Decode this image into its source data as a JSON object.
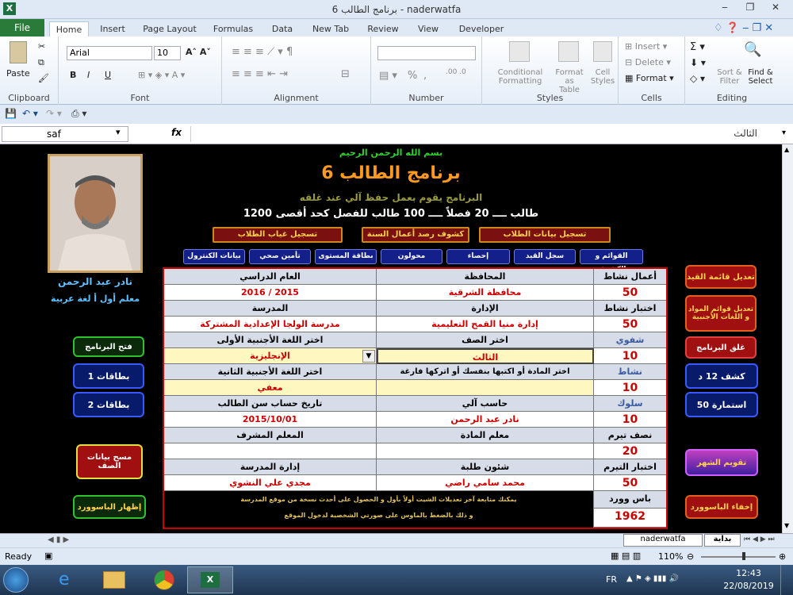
{
  "window": {
    "title": "برنامج الطالب 6  -  naderwatfa",
    "min": "▭",
    "restore": "🗗",
    "close": "✕"
  },
  "tabs": [
    "File",
    "Home",
    "Insert",
    "Page Layout",
    "Formulas",
    "Data",
    "New Tab",
    "Review",
    "View",
    "Developer"
  ],
  "ribbon": {
    "clipboard": {
      "paste": "Paste",
      "label": "Clipboard"
    },
    "font": {
      "name": "Arial",
      "size": "10",
      "label": "Font",
      "bold": "B",
      "italic": "I",
      "underline": "U"
    },
    "alignment": {
      "label": "Alignment"
    },
    "number": {
      "label": "Number",
      "percent": "%",
      "comma": ","
    },
    "styles": {
      "cond": "Conditional Formatting",
      "table": "Format as Table",
      "cell": "Cell Styles",
      "label": "Styles"
    },
    "cells": {
      "insert": "Insert",
      "delete": "Delete",
      "format": "Format",
      "label": "Cells"
    },
    "editing": {
      "sort": "Sort & Filter",
      "find": "Find & Select",
      "label": "Editing"
    }
  },
  "formula": {
    "name": "saf",
    "fx": "fx",
    "value": "الثالث"
  },
  "sheet": {
    "basmala": "بسم الله الرحمن الرحيم",
    "title": "برنامج الطالب 6",
    "subtitle": "البرنامج يقوم بعمل حفظ آلي عند غلقه",
    "capacity": "1200 طالب ــــ 20 فصلاً ــــ 100 طالب للفصل كحد أقصى",
    "teacher_name": "نادر عبد الرحمن",
    "teacher_role": "معلم أول أ لغة عربية",
    "top_buttons": [
      "تسجيل بيانات الطلاب",
      "كشوف رصد أعمال السنة",
      "تسجيل غياب الطلاب"
    ],
    "nav_buttons": [
      "القوائم و الكشوف",
      "سجل القيد",
      "إحصاء",
      "محولون",
      "بطاقة المستوى",
      "تأمين صحي",
      "بيانات الكنترول"
    ],
    "left_buttons": {
      "open": "فتح البرنامج",
      "cards1": "بطاقات 1",
      "cards2": "بطاقات 2",
      "clear": "مسح بيانات الصف",
      "show_pw": "إظهار الباسوورد"
    },
    "right_buttons": {
      "edit_list": "تعديل قائمة القيد",
      "edit_subjects": "تعديل قوائم المواد و اللغات الأجنبية",
      "close": "غلق البرنامج",
      "sheet12": "كشف 12 د",
      "form50": "استمارة 50",
      "calendar": "تقويم الشهر",
      "hide_pw": "إخفاء الباسوورد"
    },
    "table": {
      "h_year": "العام الدراسي",
      "h_gov": "المحافظة",
      "h_act": "أعمال نشاط",
      "year": "2016 / 2015",
      "gov": "محافظة الشرقية",
      "act": "50",
      "h_school": "المدرسة",
      "h_admin": "الإدارة",
      "h_test": "اختبار نشاط",
      "school": "مدرسة الولجا الإعدادية المشتركة",
      "admin": "إدارة منيا القمح التعليمية",
      "test": "50",
      "h_lang1": "اختر اللغة الأجنبية الأولى",
      "h_grade": "اختر الصف",
      "h_oral": "شفوي",
      "lang1": "الإنجليزية",
      "grade": "الثالث",
      "oral": "10",
      "h_lang2": "اختر اللغة الأجنبية الثانية",
      "h_pick": "اختر المادة أو اكتبها بنفسك أو اتركها فارغة",
      "h_activity": "نشاط",
      "lang2": "معفي",
      "activity": "10",
      "h_date": "تاريخ حساب سن الطالب",
      "h_computer": "حاسب آلي",
      "h_behave": "سلوك",
      "date": "2015/10/01",
      "computer": "نادر عبد الرحمن",
      "behave": "10",
      "h_super": "المعلم المشرف",
      "h_subj_t": "معلم المادة",
      "h_mid": "نصف تيرم",
      "mid": "20",
      "h_mgmt": "إدارة المدرسة",
      "h_affairs": "شئون طلبة",
      "h_term": "اختبار التيرم",
      "mgmt": "مجدي علي النشوي",
      "affairs": "محمد سامي راضي",
      "term": "50",
      "note1": "يمكنك متابعة آخر تعديلات الشيت أولاً بأول و الحصول على أحدث نسخة من موقع المدرسة",
      "note2": "و ذلك بالضغط بالماوس على صورتي الشخصية لدخول الموقع",
      "h_pw": "باس وورد",
      "pw": "1962"
    }
  },
  "sheet_tabs": [
    "بداية",
    "naderwatfa"
  ],
  "status": {
    "ready": "Ready",
    "zoom": "110%"
  },
  "tray": {
    "lang": "FR",
    "time": "12:43",
    "date": "22/08/2019"
  }
}
